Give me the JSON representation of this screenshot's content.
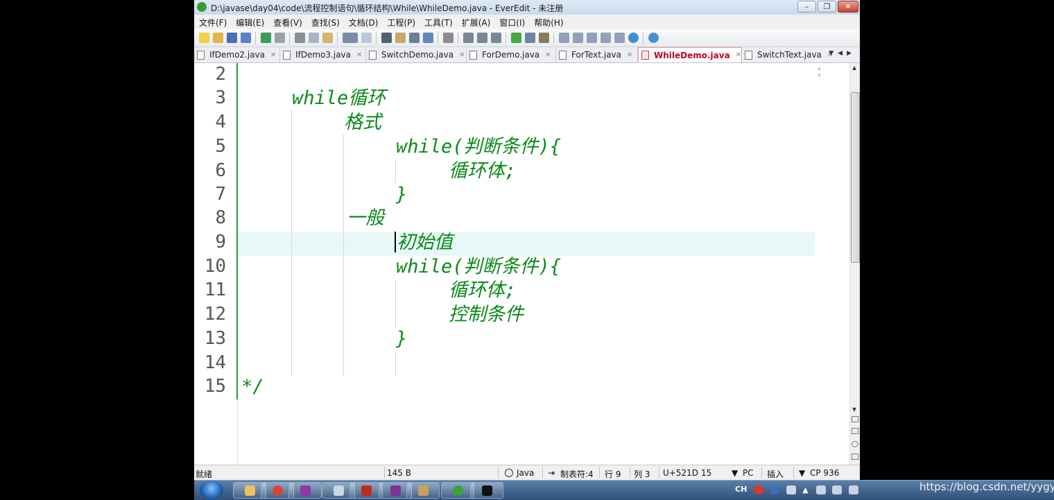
{
  "window": {
    "title": "D:\\javase\\day04\\code\\流程控制语句\\循环结构\\While\\WhileDemo.java - EverEdit - 未注册"
  },
  "menu": [
    "文件(F)",
    "编辑(E)",
    "查看(V)",
    "查找(S)",
    "文档(D)",
    "工程(P)",
    "工具(T)",
    "扩展(A)",
    "窗口(I)",
    "帮助(H)"
  ],
  "tabs": [
    {
      "label": "IfDemo2.java",
      "active": false
    },
    {
      "label": "IfDemo3.java",
      "active": false
    },
    {
      "label": "SwitchDemo.java",
      "active": false
    },
    {
      "label": "ForDemo.java",
      "active": false
    },
    {
      "label": "ForText.java",
      "active": false
    },
    {
      "label": "WhileDemo.java",
      "active": true
    },
    {
      "label": "SwitchText.java",
      "active": false
    }
  ],
  "editor": {
    "lines": [
      {
        "n": "2",
        "text": ""
      },
      {
        "n": "3",
        "text": "while循环"
      },
      {
        "n": "4",
        "text": "格式"
      },
      {
        "n": "5",
        "text": "while(判断条件){"
      },
      {
        "n": "6",
        "text": "循环体;"
      },
      {
        "n": "7",
        "text": "}"
      },
      {
        "n": "8",
        "text": "一般"
      },
      {
        "n": "9",
        "text": "初始值"
      },
      {
        "n": "10",
        "text": "while(判断条件){"
      },
      {
        "n": "11",
        "text": "循环体;"
      },
      {
        "n": "12",
        "text": "控制条件"
      },
      {
        "n": "13",
        "text": "}"
      },
      {
        "n": "14",
        "text": ""
      },
      {
        "n": "15",
        "text": "*/"
      }
    ],
    "current_line": "9",
    "code_color": "#0a8a1a",
    "highlight_color": "#e8f8f8"
  },
  "status": {
    "ready": "就绪",
    "size": "145 B",
    "language": "Java",
    "tab": "制表符:4",
    "line": "行 9",
    "col": "列 3",
    "unicode": "U+521D",
    "value": "15",
    "eol": "PC",
    "mode": "插入",
    "encoding": "CP 936"
  },
  "taskbar": {
    "tray_text": "CH"
  },
  "watermark": "https://blog.csdn.net/yygyj"
}
